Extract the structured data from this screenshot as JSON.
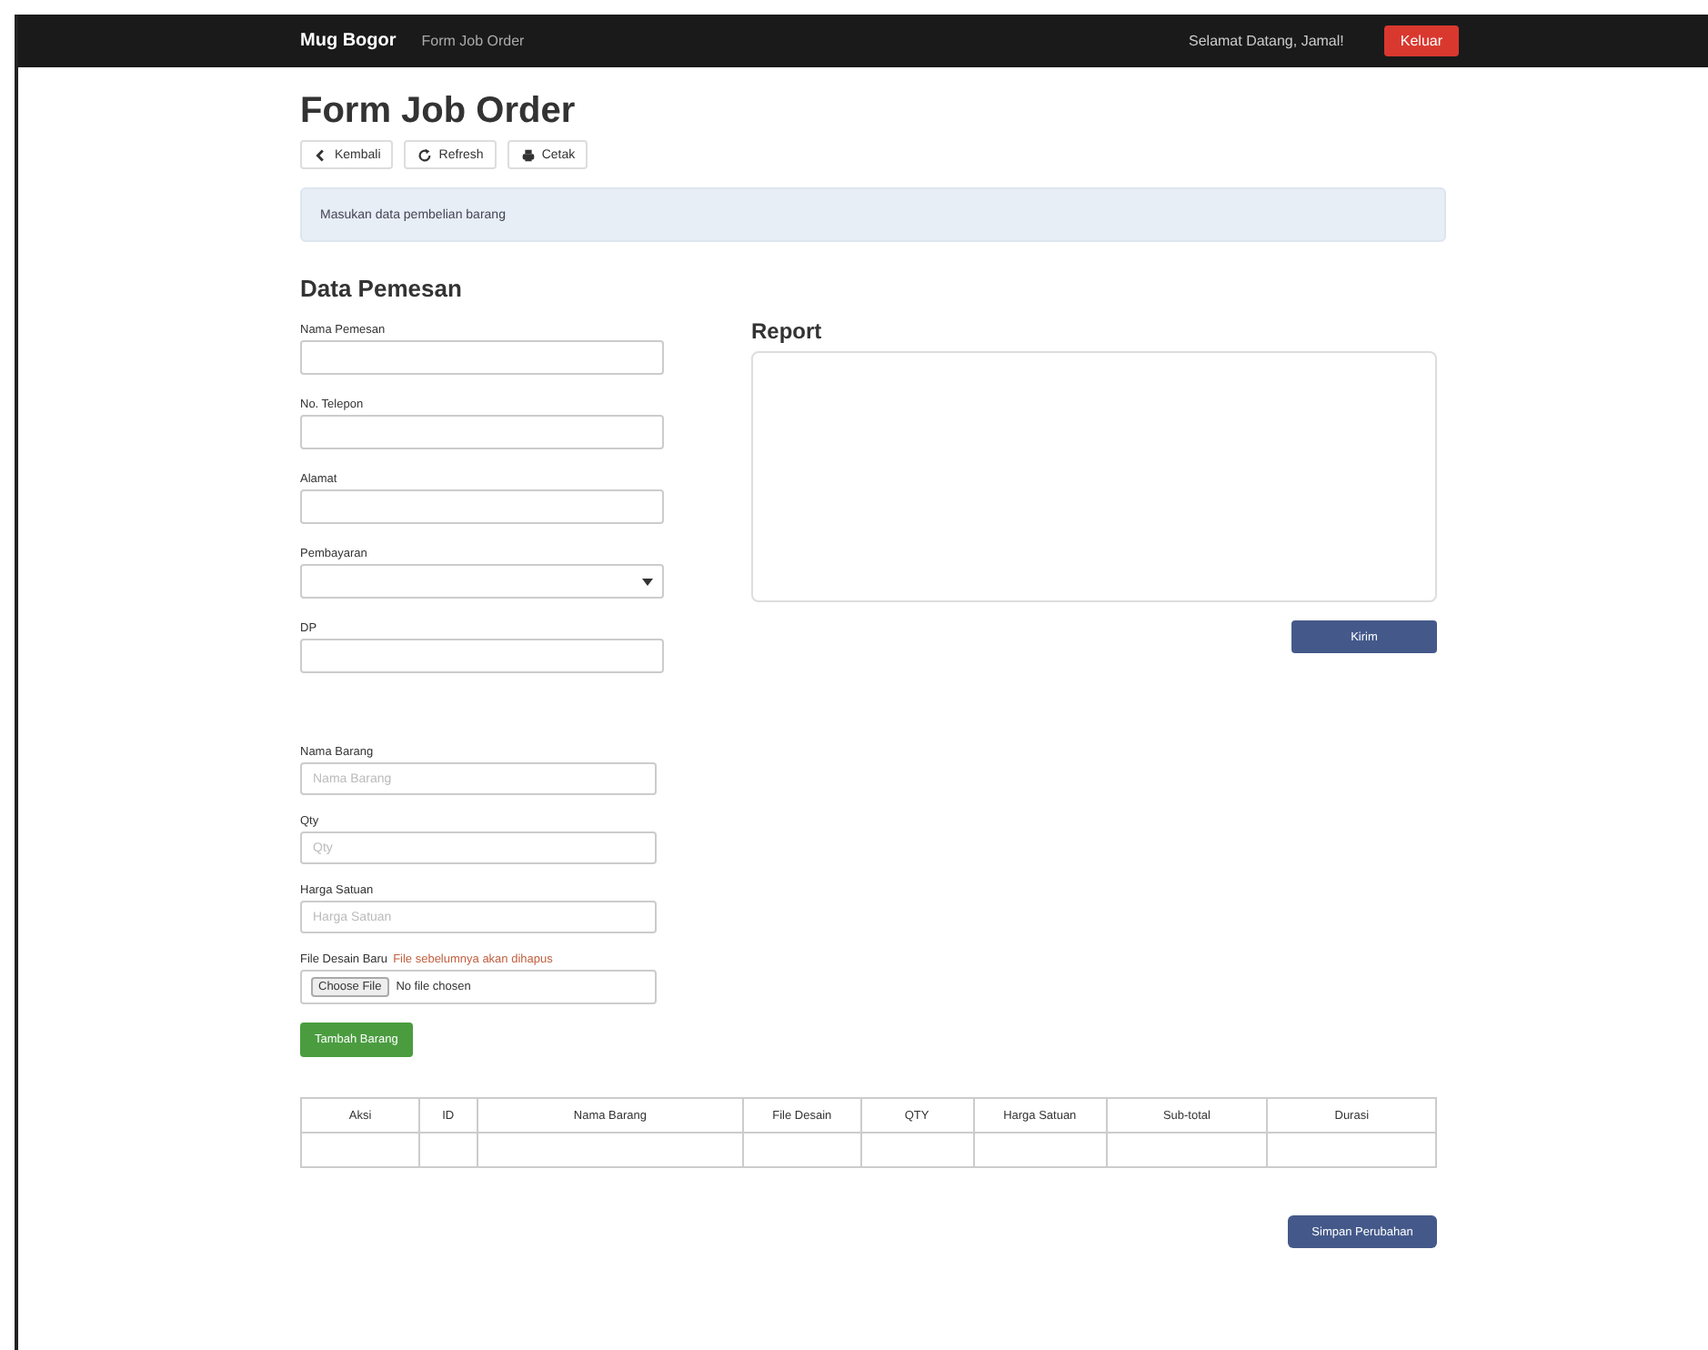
{
  "navbar": {
    "brand": "Mug Bogor",
    "page_link": "Form Job Order",
    "greeting": "Selamat Datang, Jamal!",
    "logout_button": "Keluar"
  },
  "page_title": "Form Job Order",
  "toolbar_buttons": [
    {
      "kind": "back",
      "label": "Kembali"
    },
    {
      "kind": "refresh",
      "label": "Refresh"
    },
    {
      "kind": "print",
      "label": "Cetak"
    }
  ],
  "alert": "Masukan data pembelian barang",
  "customer_section": {
    "title": "Data Pemesan",
    "fields": [
      {
        "kind": "text",
        "label": "Nama Pemesan"
      },
      {
        "kind": "text",
        "label": "No. Telepon"
      },
      {
        "kind": "text",
        "label": "Alamat"
      },
      {
        "kind": "select",
        "label": "Pembayaran"
      },
      {
        "kind": "text",
        "label": "DP"
      }
    ]
  },
  "report": {
    "title": "Report",
    "button": "Kirim"
  },
  "item_form": {
    "fields": [
      {
        "label": "Nama Barang",
        "placeholder": "Nama Barang"
      },
      {
        "label": "Qty",
        "placeholder": "Qty"
      },
      {
        "label": "Harga Satuan",
        "placeholder": "Harga Satuan"
      }
    ],
    "file_field": {
      "label": "File Desain Baru",
      "note": "File sebelumnya akan dihapus",
      "button": "Choose File",
      "status": "No file chosen"
    },
    "add_button": "Tambah Barang"
  },
  "table": {
    "columns": [
      "Aksi",
      "ID",
      "Nama Barang",
      "File Desain",
      "QTY",
      "Harga Satuan",
      "Sub-total",
      "Durasi"
    ]
  },
  "save_button": "Simpan Perubahan"
}
